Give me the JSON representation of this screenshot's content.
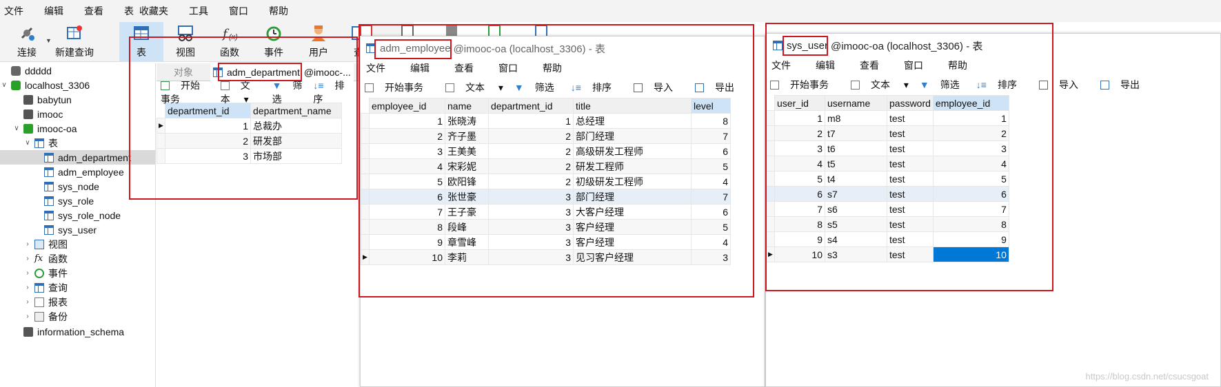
{
  "menu": [
    "文件",
    "编辑",
    "查看",
    "表",
    "收藏夹",
    "工具",
    "窗口",
    "帮助"
  ],
  "toolbar": {
    "buttons": [
      {
        "label": "连接",
        "icon": "connection-icon"
      },
      {
        "label": "新建查询",
        "icon": "new-query-icon"
      },
      {
        "label": "表",
        "icon": "table-icon"
      },
      {
        "label": "视图",
        "icon": "view-icon"
      },
      {
        "label": "函数",
        "icon": "function-icon"
      },
      {
        "label": "事件",
        "icon": "event-icon"
      },
      {
        "label": "用户",
        "icon": "user-icon"
      },
      {
        "label": "查",
        "icon": "query-icon"
      }
    ]
  },
  "tree": {
    "items": [
      {
        "label": "ddddd"
      },
      {
        "label": "localhost_3306"
      },
      {
        "label": "babytun"
      },
      {
        "label": "imooc"
      },
      {
        "label": "imooc-oa"
      },
      {
        "label": "表"
      },
      {
        "label": "adm_department"
      },
      {
        "label": "adm_employee"
      },
      {
        "label": "sys_node"
      },
      {
        "label": "sys_role"
      },
      {
        "label": "sys_role_node"
      },
      {
        "label": "sys_user"
      },
      {
        "label": "视图"
      },
      {
        "label": "函数"
      },
      {
        "label": "事件"
      },
      {
        "label": "查询"
      },
      {
        "label": "报表"
      },
      {
        "label": "备份"
      },
      {
        "label": "information_schema"
      }
    ]
  },
  "main": {
    "tabs": [
      {
        "label": "对象"
      },
      {
        "label": "adm_department"
      },
      {
        "label": "@imooc-..."
      }
    ],
    "subtool": {
      "begin": "开始事务",
      "text": "文本",
      "filter": "筛选",
      "sort": "排序"
    },
    "dept": {
      "headers": [
        "department_id",
        "department_name"
      ],
      "rows": [
        [
          "1",
          "总裁办"
        ],
        [
          "2",
          "研发部"
        ],
        [
          "3",
          "市场部"
        ]
      ]
    }
  },
  "emp_window": {
    "title_name": "adm_employee",
    "title_rest": "@imooc-oa (localhost_3306) - 表",
    "menu": [
      "文件",
      "编辑",
      "查看",
      "窗口",
      "帮助"
    ],
    "subtool": {
      "begin": "开始事务",
      "text": "文本",
      "filter": "筛选",
      "sort": "排序",
      "import": "导入",
      "export": "导出"
    },
    "headers": [
      "employee_id",
      "name",
      "department_id",
      "title",
      "level"
    ],
    "rows": [
      [
        "1",
        "张晓涛",
        "1",
        "总经理",
        "8"
      ],
      [
        "2",
        "齐子墨",
        "2",
        "部门经理",
        "7"
      ],
      [
        "3",
        "王美美",
        "2",
        "高级研发工程师",
        "6"
      ],
      [
        "4",
        "宋彩妮",
        "2",
        "研发工程师",
        "5"
      ],
      [
        "5",
        "欧阳锋",
        "2",
        "初级研发工程师",
        "4"
      ],
      [
        "6",
        "张世豪",
        "3",
        "部门经理",
        "7"
      ],
      [
        "7",
        "王子豪",
        "3",
        "大客户经理",
        "6"
      ],
      [
        "8",
        "段峰",
        "3",
        "客户经理",
        "5"
      ],
      [
        "9",
        "章雪峰",
        "3",
        "客户经理",
        "4"
      ],
      [
        "10",
        "李莉",
        "3",
        "见习客户经理",
        "3"
      ]
    ]
  },
  "user_window": {
    "title_name": "sys_user",
    "title_rest": "@imooc-oa (localhost_3306) - 表",
    "menu": [
      "文件",
      "编辑",
      "查看",
      "窗口",
      "帮助"
    ],
    "subtool": {
      "begin": "开始事务",
      "text": "文本",
      "filter": "筛选",
      "sort": "排序",
      "import": "导入",
      "export": "导出"
    },
    "headers": [
      "user_id",
      "username",
      "password",
      "employee_id"
    ],
    "rows": [
      [
        "1",
        "m8",
        "test",
        "1"
      ],
      [
        "2",
        "t7",
        "test",
        "2"
      ],
      [
        "3",
        "t6",
        "test",
        "3"
      ],
      [
        "4",
        "t5",
        "test",
        "4"
      ],
      [
        "5",
        "t4",
        "test",
        "5"
      ],
      [
        "6",
        "s7",
        "test",
        "6"
      ],
      [
        "7",
        "s6",
        "test",
        "7"
      ],
      [
        "8",
        "s5",
        "test",
        "8"
      ],
      [
        "9",
        "s4",
        "test",
        "9"
      ],
      [
        "10",
        "s3",
        "test",
        "10"
      ]
    ]
  },
  "watermark": "https://blog.csdn.net/csucsgoat",
  "colors": {
    "highlight": "#0078d7",
    "red_box": "#d0141e",
    "tab_active": "#cfe3f6"
  }
}
